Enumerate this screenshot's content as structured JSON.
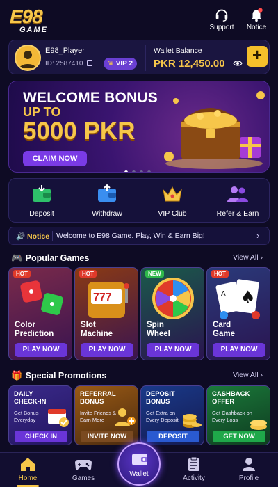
{
  "header": {
    "logo_main": "E98",
    "logo_sub": "GAME",
    "support_label": "Support",
    "notice_label": "Notice"
  },
  "user": {
    "name": "E98_Player",
    "id_text": "ID: 2587410",
    "vip": "VIP 2",
    "wallet_label": "Wallet Balance",
    "wallet_value": "PKR 12,450.00"
  },
  "banner": {
    "title": "WELCOME BONUS",
    "subtitle": "UP TO",
    "amount": "5000 PKR",
    "cta": "CLAIM NOW",
    "slide_count": 4,
    "active_slide": 1
  },
  "quick_actions": [
    {
      "label": "Deposit",
      "icon": "deposit-wallet-icon"
    },
    {
      "label": "Withdraw",
      "icon": "withdraw-wallet-icon"
    },
    {
      "label": "VIP Club",
      "icon": "crown-icon"
    },
    {
      "label": "Refer & Earn",
      "icon": "users-icon"
    }
  ],
  "notice": {
    "label": "Notice",
    "text": "Welcome to E98 Game. Play, Win & Earn Big!"
  },
  "popular": {
    "title": "Popular Games",
    "view_all": "View All",
    "games": [
      {
        "badge": "HOT",
        "title_line1": "Color",
        "title_line2": "Prediction",
        "button": "PLAY NOW"
      },
      {
        "badge": "HOT",
        "title_line1": "Slot",
        "title_line2": "Machine",
        "button": "PLAY NOW"
      },
      {
        "badge": "NEW",
        "title_line1": "Spin",
        "title_line2": "Wheel",
        "button": "PLAY NOW"
      },
      {
        "badge": "HOT",
        "title_line1": "Card",
        "title_line2": "Game",
        "button": "PLAY NOW"
      }
    ]
  },
  "promotions": {
    "title": "Special Promotions",
    "view_all": "View All",
    "items": [
      {
        "title_line1": "DAILY",
        "title_line2": "CHECK-IN",
        "desc_line1": "Get Bonus",
        "desc_line2": "Everyday",
        "button": "CHECK IN"
      },
      {
        "title_line1": "REFERRAL",
        "title_line2": "BONUS",
        "desc_line1": "Invite Friends &",
        "desc_line2": "Earn More",
        "button": "INVITE NOW"
      },
      {
        "title_line1": "DEPOSIT",
        "title_line2": "BONUS",
        "desc_line1": "Get Extra on",
        "desc_line2": "Every Deposit",
        "button": "DEPOSIT"
      },
      {
        "title_line1": "CASHBACK",
        "title_line2": "OFFER",
        "desc_line1": "Get Cashback on",
        "desc_line2": "Every Loss",
        "button": "GET NOW"
      }
    ]
  },
  "nav": {
    "home": "Home",
    "games": "Games",
    "wallet": "Wallet",
    "activity": "Activity",
    "profile": "Profile",
    "active": "Home"
  },
  "colors": {
    "background": "#0e0b24",
    "gold": "#f6c64a",
    "purple": "#6a35d8",
    "active_nav": "#f6c64a"
  }
}
